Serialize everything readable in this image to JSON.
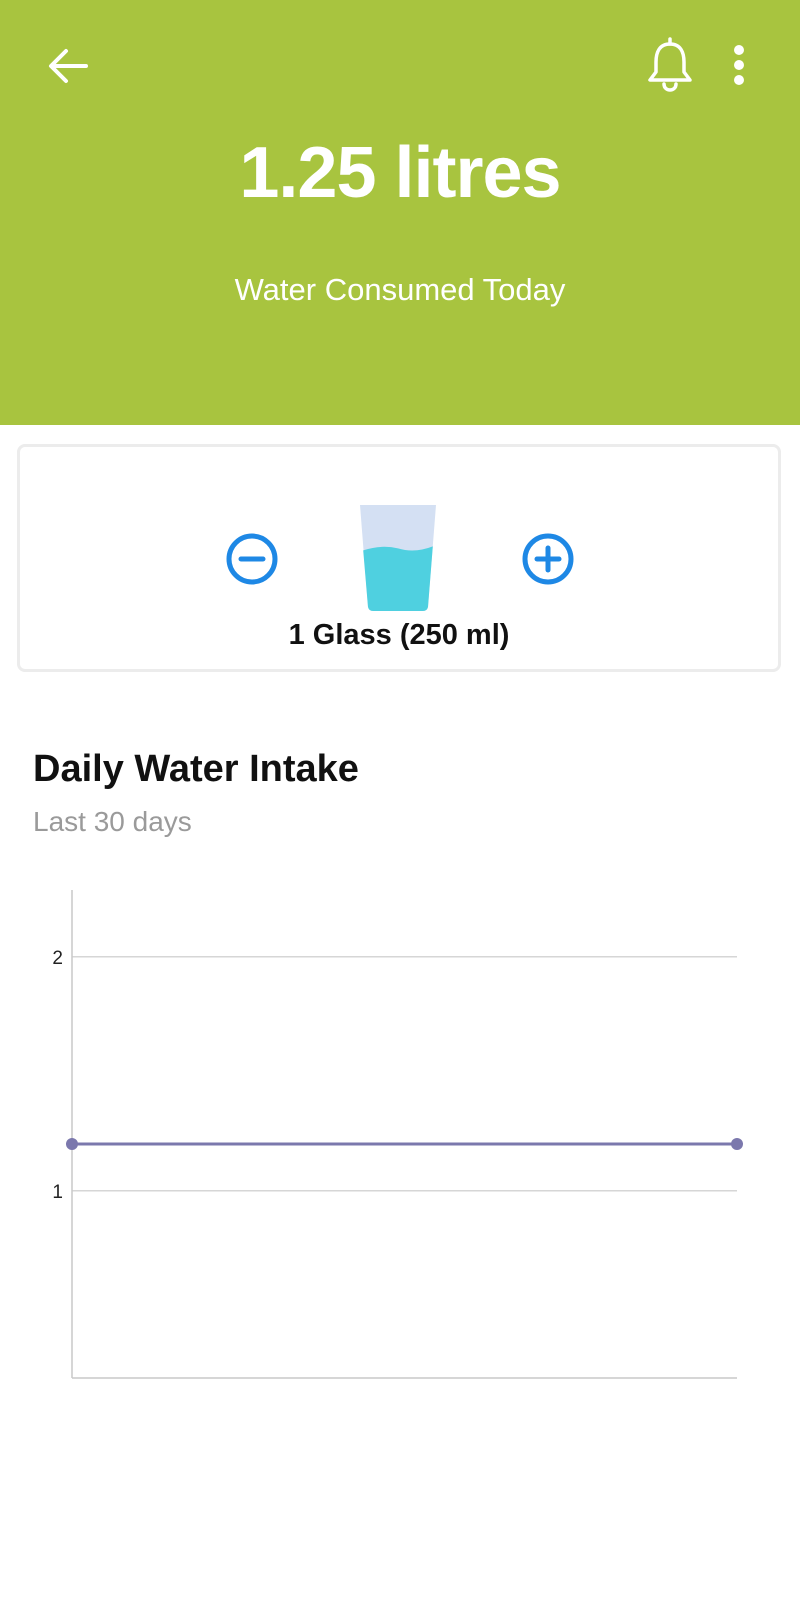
{
  "header": {
    "total_value": "1.25 litres",
    "total_caption": "Water Consumed Today",
    "background_color": "#a8c43f",
    "icons": {
      "back": "arrow-left-icon",
      "bell": "bell-icon",
      "more": "more-vertical-icon"
    }
  },
  "glass_card": {
    "label": "1 Glass (250 ml)",
    "minus_icon": "minus-circle-icon",
    "plus_icon": "plus-circle-icon",
    "glass_icon": "water-glass-icon",
    "button_color": "#1e88e5",
    "water_color": "#4fd0e0",
    "glass_color": "#d4e0f3",
    "fill_fraction": 0.6
  },
  "chart_section": {
    "title": "Daily Water Intake",
    "subtitle": "Last 30 days"
  },
  "chart_data": {
    "type": "line",
    "title": "Daily Water Intake",
    "subtitle": "Last 30 days",
    "xlabel": "",
    "ylabel": "",
    "ylim": [
      0.2,
      2.2
    ],
    "yticks": [
      1,
      2
    ],
    "grid": true,
    "series": [
      {
        "points": [
          {
            "x": 0,
            "y": 1.2
          },
          {
            "x": 1,
            "y": 1.2
          }
        ],
        "color": "#7b78ad"
      }
    ]
  }
}
